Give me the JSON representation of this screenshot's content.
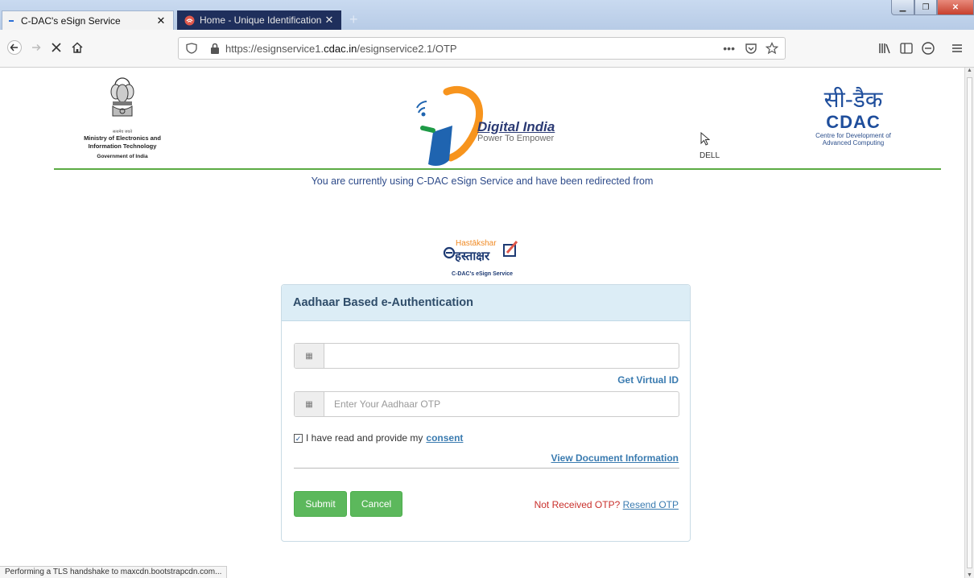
{
  "browser": {
    "tabs": [
      {
        "title": "C-DAC's eSign Service"
      },
      {
        "title": "Home - Unique Identification /"
      }
    ],
    "tab_close": "✕",
    "new_tab": "+",
    "url": {
      "prefix": "https://esignservice1.",
      "host": "cdac.in",
      "path": "/esignservice2.1/OTP"
    },
    "status_text": "Performing a TLS handshake to maxcdn.bootstrapcdn.com..."
  },
  "header": {
    "ministry_line1": "Ministry of Electronics and",
    "ministry_line2": "Information Technology",
    "government": "Government of India",
    "digital_india_title": "Digital India",
    "digital_india_tagline": "Power To Empower",
    "cursor_label": "DELL",
    "cdac_hindi": "सी-डैक",
    "cdac_name": "CDAC",
    "cdac_desc_line1": "Centre for Development of",
    "cdac_desc_line2": "Advanced Computing"
  },
  "redirect_message": "You are currently using C-DAC eSign Service and have been redirected from",
  "hastakshar": {
    "latin": "Hastākshar",
    "hindi": "हस्ताक्षर",
    "subtitle": "C-DAC's eSign Service"
  },
  "form": {
    "title": "Aadhaar Based e-Authentication",
    "aadhaar_value": "",
    "get_virtual_id": "Get Virtual ID",
    "otp_placeholder": "Enter Your Aadhaar OTP",
    "consent_text": "I have read and provide my",
    "consent_link": "consent",
    "view_document": "View Document Information",
    "submit_label": "Submit",
    "cancel_label": "Cancel",
    "not_received": "Not Received OTP?",
    "resend": "Resend OTP"
  },
  "colors": {
    "accent_green": "#5cb85c",
    "header_line": "#5bab43",
    "link": "#3a7bb0",
    "panel_head": "#dcedf6"
  }
}
